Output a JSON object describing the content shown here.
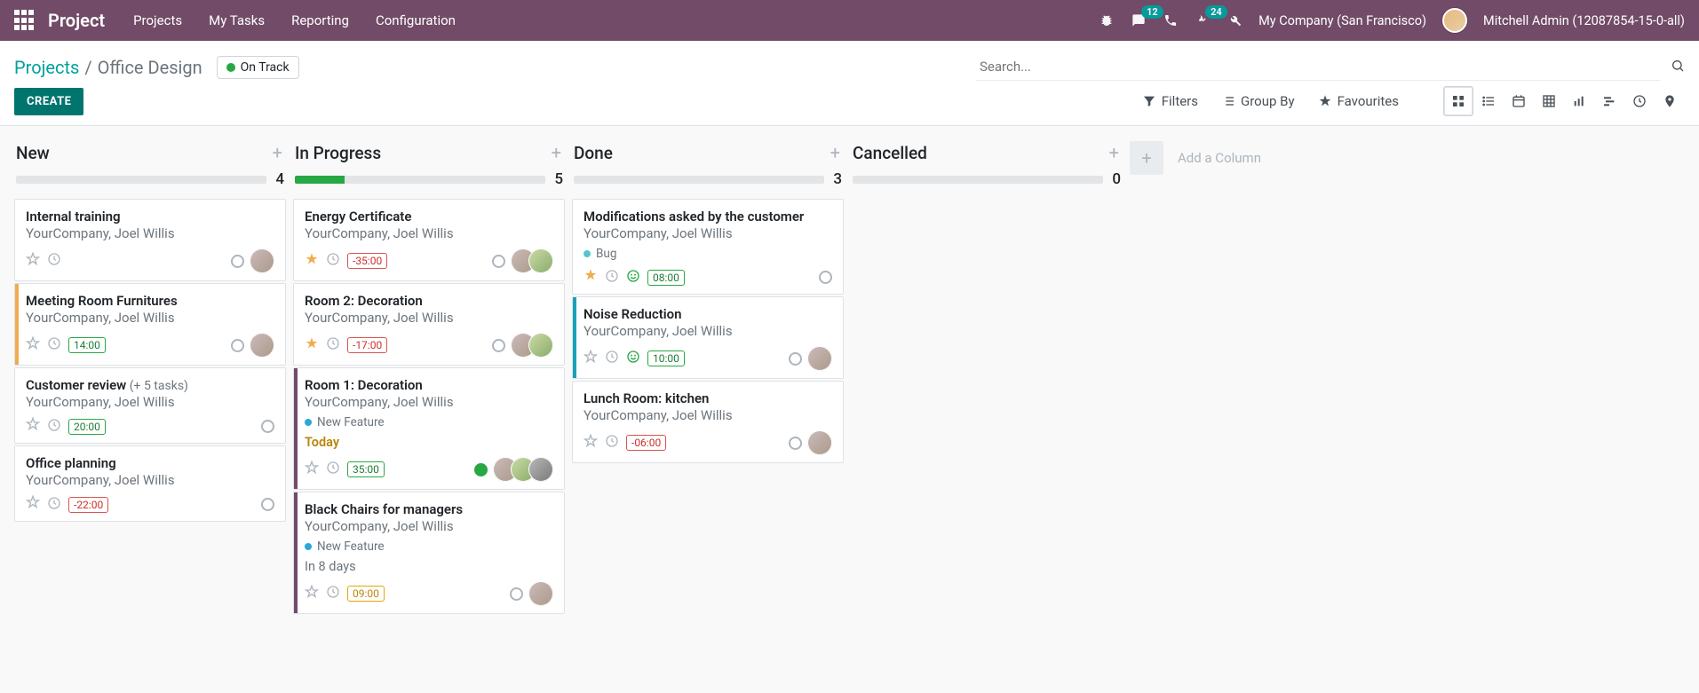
{
  "brand": "Project",
  "nav": {
    "links": [
      "Projects",
      "My Tasks",
      "Reporting",
      "Configuration"
    ],
    "messages_badge": "12",
    "activities_badge": "24",
    "company": "My Company (San Francisco)",
    "user": "Mitchell Admin (12087854-15-0-all)"
  },
  "breadcrumb": {
    "link": "Projects",
    "sep": "/",
    "current": "Office Design"
  },
  "status": {
    "label": "On Track"
  },
  "create": "CREATE",
  "search": {
    "placeholder": "Search..."
  },
  "filters": {
    "filters": "Filters",
    "groupby": "Group By",
    "favourites": "Favourites"
  },
  "add_column": "Add a Column",
  "columns": [
    {
      "title": "New",
      "count": "4",
      "progress": 0,
      "cards": [
        {
          "title": "Internal training",
          "sub": "YourCompany, Joel Willis",
          "star": false,
          "pill": null,
          "avatars": 1,
          "state": "empty"
        },
        {
          "title": "Meeting Room Furnitures",
          "sub": "YourCompany, Joel Willis",
          "star": false,
          "pill": {
            "text": "14:00",
            "tone": "green"
          },
          "avatars": 1,
          "state": "empty",
          "stripe": "yellow"
        },
        {
          "title": "Customer review",
          "extra": "(+ 5 tasks)",
          "sub": "YourCompany, Joel Willis",
          "star": false,
          "pill": {
            "text": "20:00",
            "tone": "green"
          },
          "avatars": 0,
          "state": "empty"
        },
        {
          "title": "Office planning",
          "sub": "YourCompany, Joel Willis",
          "star": false,
          "pill": {
            "text": "-22:00",
            "tone": "red"
          },
          "avatars": 0,
          "state": "empty"
        }
      ]
    },
    {
      "title": "In Progress",
      "count": "5",
      "progress": 20,
      "cards": [
        {
          "title": "Energy Certificate",
          "sub": "YourCompany, Joel Willis",
          "star": true,
          "pill": {
            "text": "-35:00",
            "tone": "red"
          },
          "avatars": 2,
          "state": "empty"
        },
        {
          "title": "Room 2: Decoration",
          "sub": "YourCompany, Joel Willis",
          "star": true,
          "pill": {
            "text": "-17:00",
            "tone": "red"
          },
          "avatars": 2,
          "state": "empty"
        },
        {
          "title": "Room 1: Decoration",
          "sub": "YourCompany, Joel Willis",
          "tag": {
            "color": "tblue",
            "text": "New Feature"
          },
          "due": {
            "text": "Today",
            "tone": "today"
          },
          "star": false,
          "pill": {
            "text": "35:00",
            "tone": "green"
          },
          "avatars": 3,
          "state": "fill",
          "stripe": "purple"
        },
        {
          "title": "Black Chairs for managers",
          "sub": "YourCompany, Joel Willis",
          "tag": {
            "color": "tblue",
            "text": "New Feature"
          },
          "due": {
            "text": "In 8 days",
            "tone": "normal"
          },
          "star": false,
          "pill": {
            "text": "09:00",
            "tone": "amber"
          },
          "avatars": 1,
          "state": "empty",
          "stripe": "purple"
        }
      ]
    },
    {
      "title": "Done",
      "count": "3",
      "progress": 0,
      "cards": [
        {
          "title": "Modifications asked by the customer",
          "sub": "YourCompany, Joel Willis",
          "tag": {
            "color": "tcyan",
            "text": "Bug"
          },
          "star": true,
          "pill": {
            "text": "08:00",
            "tone": "green"
          },
          "smiley": true,
          "avatars": 0,
          "state": "empty"
        },
        {
          "title": "Noise Reduction",
          "sub": "YourCompany, Joel Willis",
          "star": false,
          "pill": {
            "text": "10:00",
            "tone": "green"
          },
          "smiley": true,
          "avatars": 1,
          "state": "empty",
          "stripe": "blue"
        },
        {
          "title": "Lunch Room: kitchen",
          "sub": "YourCompany, Joel Willis",
          "star": false,
          "pill": {
            "text": "-06:00",
            "tone": "red"
          },
          "avatars": 1,
          "state": "empty"
        }
      ]
    },
    {
      "title": "Cancelled",
      "count": "0",
      "progress": 0,
      "cards": []
    }
  ]
}
